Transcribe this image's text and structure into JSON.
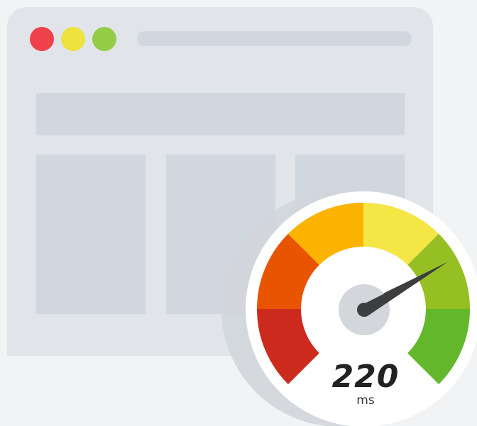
{
  "browser": {
    "traffic_lights": [
      {
        "name": "close",
        "color": "#f0424a"
      },
      {
        "name": "minimize",
        "color": "#ede23e"
      },
      {
        "name": "maximize",
        "color": "#93cd48"
      }
    ]
  },
  "gauge": {
    "value": "220",
    "unit": "ms",
    "segment_colors": [
      "#cd2a1e",
      "#e85400",
      "#fbb300",
      "#f4e645",
      "#95bf23",
      "#62b82a"
    ]
  }
}
